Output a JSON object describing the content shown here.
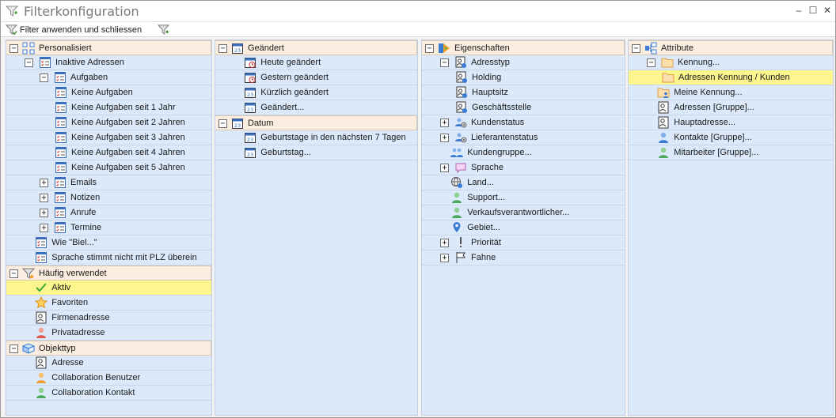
{
  "window": {
    "title": "Filterkonfiguration",
    "minimize": "‒",
    "maximize": "☐",
    "close": "✕"
  },
  "toolbar": {
    "apply_label": "Filter anwenden und schliessen"
  },
  "panels": [
    {
      "rows": [
        {
          "level": 0,
          "exp": "−",
          "icon": "sitemap-icon",
          "label": "Personalisiert",
          "header": true
        },
        {
          "level": 1,
          "exp": "−",
          "icon": "checklist-icon",
          "label": "Inaktive Adressen"
        },
        {
          "level": 2,
          "exp": "−",
          "icon": "checklist-icon",
          "label": "Aufgaben"
        },
        {
          "level": 3,
          "exp": "",
          "icon": "checklist-icon",
          "label": "Keine Aufgaben"
        },
        {
          "level": 3,
          "exp": "",
          "icon": "checklist-icon",
          "label": "Keine Aufgaben seit 1 Jahr"
        },
        {
          "level": 3,
          "exp": "",
          "icon": "checklist-icon",
          "label": "Keine Aufgaben seit 2 Jahren"
        },
        {
          "level": 3,
          "exp": "",
          "icon": "checklist-icon",
          "label": "Keine Aufgaben seit 3 Jahren"
        },
        {
          "level": 3,
          "exp": "",
          "icon": "checklist-icon",
          "label": "Keine Aufgaben seit 4 Jahren"
        },
        {
          "level": 3,
          "exp": "",
          "icon": "checklist-icon",
          "label": "Keine Aufgaben seit 5 Jahren"
        },
        {
          "level": 2,
          "exp": "+",
          "icon": "checklist-icon",
          "label": "Emails"
        },
        {
          "level": 2,
          "exp": "+",
          "icon": "checklist-icon",
          "label": "Notizen"
        },
        {
          "level": 2,
          "exp": "+",
          "icon": "checklist-icon",
          "label": "Anrufe"
        },
        {
          "level": 2,
          "exp": "+",
          "icon": "checklist-icon",
          "label": "Termine"
        },
        {
          "level": 1.7,
          "exp": "",
          "icon": "checklist-icon",
          "label": "Wie \"Biel...\""
        },
        {
          "level": 1.7,
          "exp": "",
          "icon": "checklist-icon",
          "label": "Sprache stimmt nicht mit PLZ überein"
        },
        {
          "level": 0,
          "exp": "−",
          "icon": "funnel-star-icon",
          "label": "Häufig verwendet",
          "header": true
        },
        {
          "level": 1.7,
          "exp": "",
          "icon": "checkmark-icon",
          "label": "Aktiv",
          "highlight": true
        },
        {
          "level": 1.7,
          "exp": "",
          "icon": "star-icon",
          "label": "Favoriten"
        },
        {
          "level": 1.7,
          "exp": "",
          "icon": "address-card-icon",
          "label": "Firmenadresse"
        },
        {
          "level": 1.7,
          "exp": "",
          "icon": "person-red-icon",
          "label": "Privatadresse"
        },
        {
          "level": 0,
          "exp": "−",
          "icon": "cube-icon",
          "label": "Objekttyp",
          "header": true
        },
        {
          "level": 1.7,
          "exp": "",
          "icon": "address-card-icon",
          "label": "Adresse"
        },
        {
          "level": 1.7,
          "exp": "",
          "icon": "person-orange-icon",
          "label": "Collaboration Benutzer"
        },
        {
          "level": 1.7,
          "exp": "",
          "icon": "person-green-icon",
          "label": "Collaboration Kontakt"
        }
      ]
    },
    {
      "rows": [
        {
          "level": 0,
          "exp": "−",
          "icon": "calendar-icon",
          "label": "Geändert",
          "header": true
        },
        {
          "level": 1.7,
          "exp": "",
          "icon": "calendar-clock-icon",
          "label": "Heute geändert"
        },
        {
          "level": 1.7,
          "exp": "",
          "icon": "calendar-clock-icon",
          "label": "Gestern geändert"
        },
        {
          "level": 1.7,
          "exp": "",
          "icon": "calendar-icon",
          "label": "Kürzlich geändert"
        },
        {
          "level": 1.7,
          "exp": "",
          "icon": "calendar-icon",
          "label": "Geändert..."
        },
        {
          "level": 0,
          "exp": "−",
          "icon": "calendar-icon",
          "label": "Datum",
          "header": true
        },
        {
          "level": 1.7,
          "exp": "",
          "icon": "calendar-icon",
          "label": "Geburtstage in den nächsten 7 Tagen"
        },
        {
          "level": 1.7,
          "exp": "",
          "icon": "calendar-icon",
          "label": "Geburtstag..."
        }
      ]
    },
    {
      "rows": [
        {
          "level": 0,
          "exp": "−",
          "icon": "properties-icon",
          "label": "Eigenschaften",
          "header": true
        },
        {
          "level": 1,
          "exp": "−",
          "icon": "address-type-icon",
          "label": "Adresstyp"
        },
        {
          "level": 2,
          "exp": "",
          "icon": "address-type-icon",
          "label": "Holding"
        },
        {
          "level": 2,
          "exp": "",
          "icon": "address-type-icon",
          "label": "Hauptsitz"
        },
        {
          "level": 2,
          "exp": "",
          "icon": "address-type-icon",
          "label": "Geschäftsstelle"
        },
        {
          "level": 1,
          "exp": "+",
          "icon": "people-gear-icon",
          "label": "Kundenstatus"
        },
        {
          "level": 1,
          "exp": "+",
          "icon": "people-gear-icon",
          "label": "Lieferantenstatus"
        },
        {
          "level": 1.7,
          "exp": "",
          "icon": "people-group-icon",
          "label": "Kundengruppe..."
        },
        {
          "level": 1,
          "exp": "+",
          "icon": "speech-bubble-icon",
          "label": "Sprache"
        },
        {
          "level": 1.7,
          "exp": "",
          "icon": "globe-icon",
          "label": "Land..."
        },
        {
          "level": 1.7,
          "exp": "",
          "icon": "person-green-icon",
          "label": "Support..."
        },
        {
          "level": 1.7,
          "exp": "",
          "icon": "person-green-icon",
          "label": "Verkaufsverantwortlicher..."
        },
        {
          "level": 1.7,
          "exp": "",
          "icon": "map-pin-icon",
          "label": "Gebiet..."
        },
        {
          "level": 1,
          "exp": "+",
          "icon": "exclamation-icon",
          "label": "Priorität"
        },
        {
          "level": 1,
          "exp": "+",
          "icon": "flag-icon",
          "label": "Fahne"
        }
      ]
    },
    {
      "rows": [
        {
          "level": 0,
          "exp": "−",
          "icon": "attribute-tree-icon",
          "label": "Attribute",
          "header": true
        },
        {
          "level": 1,
          "exp": "−",
          "icon": "folder-icon",
          "label": "Kennung..."
        },
        {
          "level": 2,
          "exp": "",
          "icon": "folder-icon",
          "label": "Adressen Kennung / Kunden",
          "highlight": true
        },
        {
          "level": 1.7,
          "exp": "",
          "icon": "folder-person-icon",
          "label": "Meine Kennung..."
        },
        {
          "level": 1.7,
          "exp": "",
          "icon": "address-card-icon",
          "label": "Adressen [Gruppe]..."
        },
        {
          "level": 1.7,
          "exp": "",
          "icon": "address-card-icon",
          "label": "Hauptadresse..."
        },
        {
          "level": 1.7,
          "exp": "",
          "icon": "person-blue-icon",
          "label": "Kontakte [Gruppe]..."
        },
        {
          "level": 1.7,
          "exp": "",
          "icon": "person-green-icon",
          "label": "Mitarbeiter [Gruppe]..."
        }
      ]
    }
  ]
}
